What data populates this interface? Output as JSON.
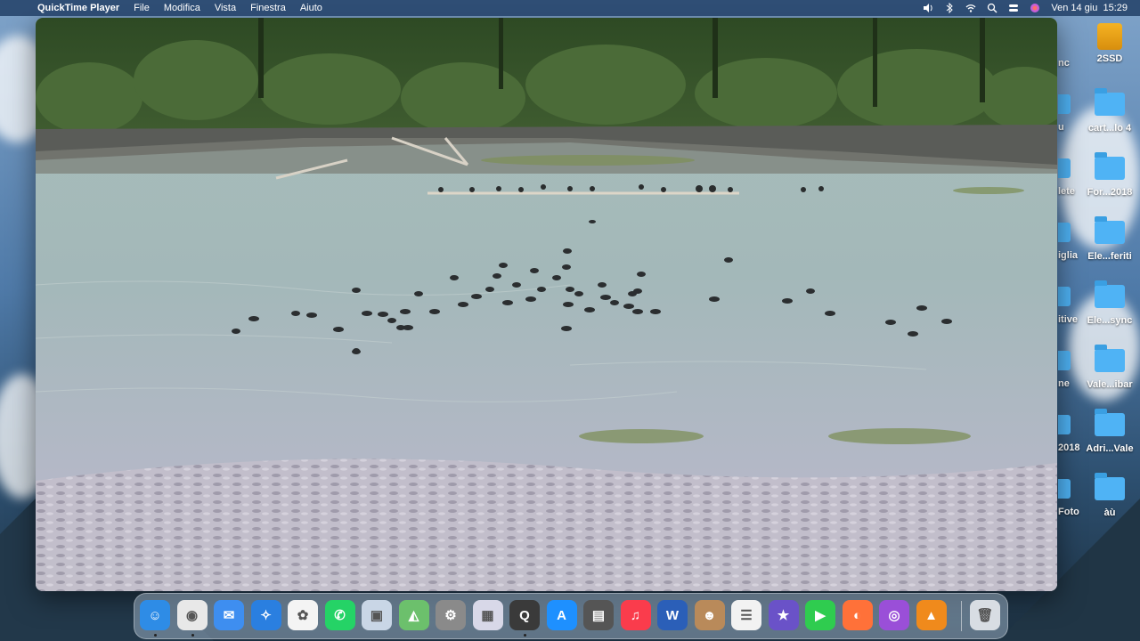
{
  "menubar": {
    "app_name": "QuickTime Player",
    "menus": [
      "File",
      "Modifica",
      "Vista",
      "Finestra",
      "Aiuto"
    ],
    "clock": "Ven 14 giu  15:29"
  },
  "desktop": {
    "icons": [
      {
        "label": "2SSD",
        "type": "drive"
      },
      {
        "label": "cart...lo 4",
        "type": "folder"
      },
      {
        "label": "For...2018",
        "type": "folder"
      },
      {
        "label": "Ele...feriti",
        "type": "folder"
      },
      {
        "label": "Ele...sync",
        "type": "folder"
      },
      {
        "label": "Vale...ibar",
        "type": "folder"
      },
      {
        "label": "Adri...Vale",
        "type": "folder"
      },
      {
        "label": "àù",
        "type": "folder"
      }
    ],
    "partial_icons": [
      "nc",
      "u",
      "lete",
      "iglia",
      "itive",
      "ne",
      "2018",
      "Foto"
    ]
  },
  "dock": {
    "apps": [
      {
        "name": "finder",
        "color": "#2e8ce6",
        "glyph": "☺",
        "running": true
      },
      {
        "name": "chrome",
        "color": "#e8e8e8",
        "glyph": "◉",
        "running": true
      },
      {
        "name": "mail",
        "color": "#3e8ef0",
        "glyph": "✉",
        "running": false
      },
      {
        "name": "safari",
        "color": "#2a7fe0",
        "glyph": "✧",
        "running": false
      },
      {
        "name": "photos",
        "color": "#f4f4f4",
        "glyph": "✿",
        "running": false
      },
      {
        "name": "whatsapp",
        "color": "#25d366",
        "glyph": "✆",
        "running": false
      },
      {
        "name": "preview",
        "color": "#c9d6e6",
        "glyph": "▣",
        "running": false
      },
      {
        "name": "maps",
        "color": "#6cc06c",
        "glyph": "◭",
        "running": false
      },
      {
        "name": "system-settings",
        "color": "#8a8a8a",
        "glyph": "⚙",
        "running": false
      },
      {
        "name": "launchpad",
        "color": "#d8d8e8",
        "glyph": "▦",
        "running": false
      },
      {
        "name": "quicktime",
        "color": "#3a3a3a",
        "glyph": "Q",
        "running": true
      },
      {
        "name": "app-store",
        "color": "#1e90ff",
        "glyph": "A",
        "running": false
      },
      {
        "name": "calculator",
        "color": "#555555",
        "glyph": "▤",
        "running": false
      },
      {
        "name": "music",
        "color": "#fa3c4c",
        "glyph": "♫",
        "running": false
      },
      {
        "name": "word",
        "color": "#2b5fb8",
        "glyph": "W",
        "running": false
      },
      {
        "name": "contacts",
        "color": "#b98a5a",
        "glyph": "☻",
        "running": false
      },
      {
        "name": "reminders",
        "color": "#f2f2f2",
        "glyph": "☰",
        "running": false
      },
      {
        "name": "imovie",
        "color": "#6a52c8",
        "glyph": "★",
        "running": false
      },
      {
        "name": "facetime",
        "color": "#2fcc4f",
        "glyph": "▶",
        "running": false
      },
      {
        "name": "firefox",
        "color": "#ff7139",
        "glyph": "◐",
        "running": false
      },
      {
        "name": "podcasts",
        "color": "#9a4fd8",
        "glyph": "◎",
        "running": false
      },
      {
        "name": "vlc",
        "color": "#f08a1c",
        "glyph": "▲",
        "running": false
      },
      {
        "name": "trash",
        "color": "#d8dde3",
        "glyph": "🗑",
        "running": false
      }
    ]
  }
}
